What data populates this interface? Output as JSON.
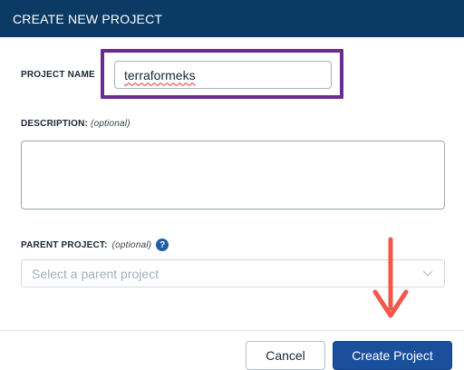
{
  "dialog": {
    "title": "CREATE NEW PROJECT"
  },
  "form": {
    "project_name_label": "PROJECT NAME",
    "project_name_value": "terraformeks",
    "description_label": "DESCRIPTION:",
    "description_optional": "(optional)",
    "description_value": "",
    "parent_label": "PARENT PROJECT:",
    "parent_optional": "(optional)",
    "parent_help_glyph": "?",
    "parent_placeholder": "Select a parent project"
  },
  "footer": {
    "cancel_label": "Cancel",
    "create_label": "Create Project"
  },
  "annotations": {
    "highlight_color": "#6a2c91",
    "arrow_color": "#f2584a"
  },
  "colors": {
    "header_bg": "#0b3a64",
    "primary_button": "#1a4f9c",
    "help_icon": "#1f5fa6"
  }
}
